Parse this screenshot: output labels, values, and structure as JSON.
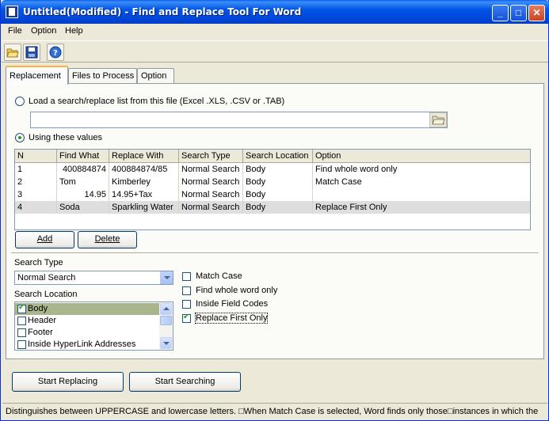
{
  "window": {
    "title": "Untitled(Modified) - Find and Replace Tool For Word",
    "controls": [
      "minimize",
      "maximize",
      "close"
    ]
  },
  "menu": [
    "File",
    "Option",
    "Help"
  ],
  "toolbar": {
    "icons": [
      "open-folder-icon",
      "save-disk-icon",
      "help-icon"
    ]
  },
  "tabs": [
    {
      "label": "Replacement",
      "active": true
    },
    {
      "label": "Files to Process",
      "active": false
    },
    {
      "label": "Option",
      "active": false
    }
  ],
  "replacement": {
    "load_radio_label": "Load a search/replace list from this file (Excel .XLS, .CSV or .TAB)",
    "file_path_value": "",
    "using_values_label": "Using these values",
    "using_values_selected": true,
    "grid": {
      "columns": [
        "N",
        "Find What",
        "Replace With",
        "Search Type",
        "Search Location",
        "Option"
      ],
      "rows": [
        {
          "n": "1",
          "find": "400884874",
          "replace": "400884874/85",
          "type": "Normal Search",
          "location": "Body",
          "option": "Find whole word only"
        },
        {
          "n": "2",
          "find": "Tom",
          "replace": "Kimberley",
          "type": "Normal Search",
          "location": "Body",
          "option": "Match Case"
        },
        {
          "n": "3",
          "find": "14.95",
          "replace": "14.95+Tax",
          "type": "Normal Search",
          "location": "Body",
          "option": ""
        },
        {
          "n": "4",
          "find": "Soda",
          "replace": "Sparkling Water",
          "type": "Normal Search",
          "location": "Body",
          "option": "Replace First Only"
        }
      ],
      "selected_row": 4
    },
    "add_label": "Add",
    "delete_label": "Delete",
    "search_type_label": "Search Type",
    "search_type_value": "Normal Search",
    "search_location_label": "Search Location",
    "locations": [
      {
        "label": "Body",
        "checked": true
      },
      {
        "label": "Header",
        "checked": false
      },
      {
        "label": "Footer",
        "checked": false
      },
      {
        "label": "Inside HyperLink Addresses",
        "checked": false
      }
    ],
    "options": [
      {
        "label": "Match Case",
        "checked": false
      },
      {
        "label": "Find whole word only",
        "checked": false
      },
      {
        "label": "Inside Field  Codes",
        "checked": false
      },
      {
        "label": "Replace First Only",
        "checked": true
      }
    ]
  },
  "buttons": {
    "start_replacing": "Start Replacing",
    "start_searching": "Start Searching"
  },
  "status": "Distinguishes between UPPERCASE and lowercase letters. □When Match Case is selected, Word finds only those□instances in which the"
}
